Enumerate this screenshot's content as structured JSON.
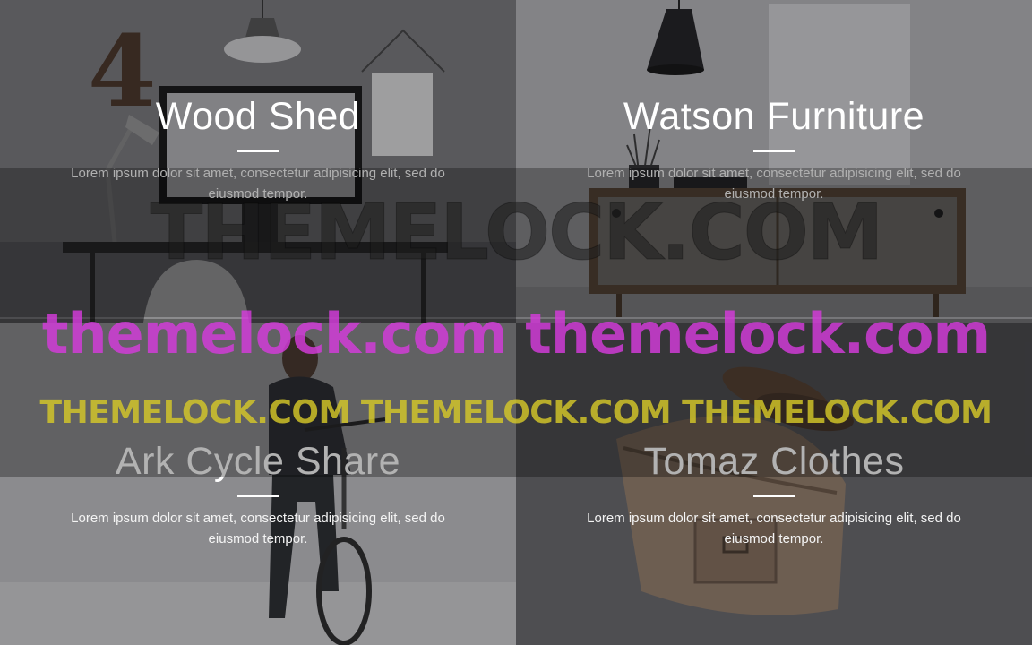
{
  "projects": [
    {
      "title": "Wood Shed",
      "description": "Lorem ipsum dolor sit amet, consectetur adipisicing elit, sed do eiusmod tempor."
    },
    {
      "title": "Watson Furniture",
      "description": "Lorem ipsum dolor sit amet, consectetur adipisicing elit, sed do eiusmod tempor."
    },
    {
      "title": "Ark Cycle Share",
      "description": "Lorem ipsum dolor sit amet, consectetur adipisicing elit, sed do eiusmod tempor."
    },
    {
      "title": "Tomaz Clothes",
      "description": "Lorem ipsum dolor sit amet, consectetur adipisicing elit, sed do eiusmod tempor."
    }
  ],
  "watermarks": {
    "large": "THEMELOCK.COM",
    "pink": "themelock.com  themelock.com",
    "yellow": "THEMELOCK.COM THEMELOCK.COM THEMELOCK.COM"
  },
  "colors": {
    "caption_text": "#ffffff",
    "watermark_pink": "#d63cdc",
    "watermark_yellow": "#d6c828"
  }
}
